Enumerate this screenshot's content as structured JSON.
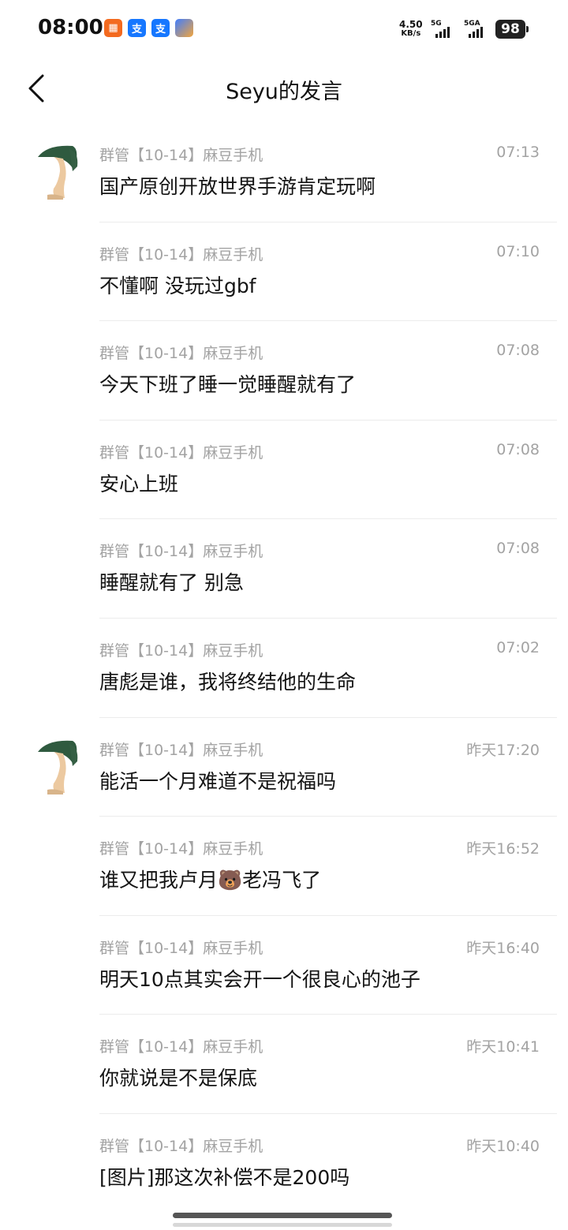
{
  "status_bar": {
    "time": "08:00",
    "net_speed_value": "4.50",
    "net_speed_unit": "KB/s",
    "signal1_label": "5G",
    "signal2_label": "5GA",
    "battery": "98",
    "app_icons": [
      "news-app-icon",
      "alipay-icon",
      "alipay-icon",
      "app-store-icon"
    ]
  },
  "header": {
    "title": "Seyu的发言",
    "back_icon": "chevron-left-icon"
  },
  "messages": [
    {
      "meta": "群管【10-14】麻豆手机",
      "time": "07:13",
      "text": "国产原创开放世界手游肯定玩啊",
      "show_avatar": true
    },
    {
      "meta": "群管【10-14】麻豆手机",
      "time": "07:10",
      "text": "不懂啊 没玩过gbf",
      "show_avatar": false
    },
    {
      "meta": "群管【10-14】麻豆手机",
      "time": "07:08",
      "text": "今天下班了睡一觉睡醒就有了",
      "show_avatar": false
    },
    {
      "meta": "群管【10-14】麻豆手机",
      "time": "07:08",
      "text": "安心上班",
      "show_avatar": false
    },
    {
      "meta": "群管【10-14】麻豆手机",
      "time": "07:08",
      "text": "睡醒就有了 别急",
      "show_avatar": false
    },
    {
      "meta": "群管【10-14】麻豆手机",
      "time": "07:02",
      "text": "唐彪是谁，我将终结他的生命",
      "show_avatar": false
    },
    {
      "meta": "群管【10-14】麻豆手机",
      "time": "昨天17:20",
      "text": "能活一个月难道不是祝福吗",
      "show_avatar": true
    },
    {
      "meta": "群管【10-14】麻豆手机",
      "time": "昨天16:52",
      "text": "谁又把我卢月🐻老冯飞了",
      "show_avatar": false
    },
    {
      "meta": "群管【10-14】麻豆手机",
      "time": "昨天16:40",
      "text": "明天10点其实会开一个很良心的池子",
      "show_avatar": false
    },
    {
      "meta": "群管【10-14】麻豆手机",
      "time": "昨天10:41",
      "text": "你就说是不是保底",
      "show_avatar": false
    },
    {
      "meta": "群管【10-14】麻豆手机",
      "time": "昨天10:40",
      "text": "[图片]那这次补偿不是200吗",
      "show_avatar": false
    }
  ]
}
